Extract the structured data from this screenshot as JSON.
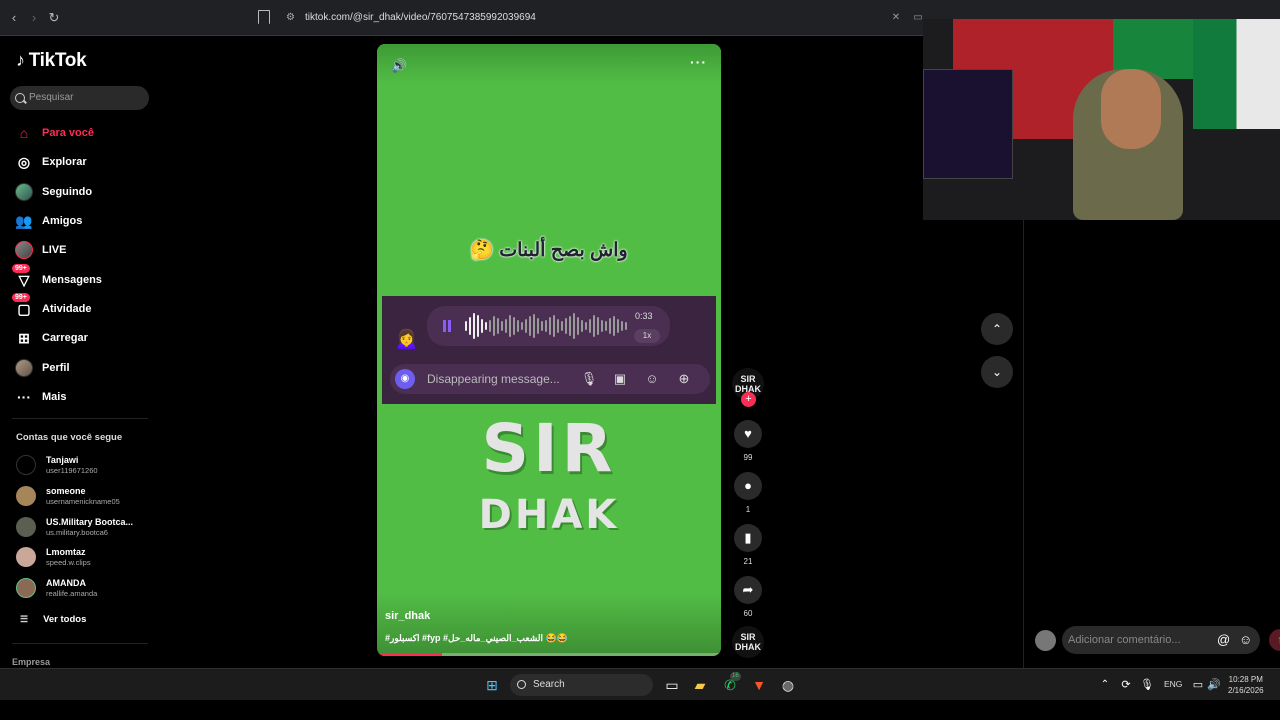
{
  "browser": {
    "url": "tiktok.com/@sir_dhak/video/7607547385992039694"
  },
  "sidebar": {
    "logo": "TikTok",
    "search_placeholder": "Pesquisar",
    "items": [
      {
        "label": "Para você",
        "icon": "home-icon",
        "active": true
      },
      {
        "label": "Explorar",
        "icon": "compass-icon"
      },
      {
        "label": "Seguindo",
        "icon": "following-avatar"
      },
      {
        "label": "Amigos",
        "icon": "friends-icon"
      },
      {
        "label": "LIVE",
        "icon": "live-avatar"
      },
      {
        "label": "Mensagens",
        "icon": "messages-icon",
        "badge": "99+"
      },
      {
        "label": "Atividade",
        "icon": "activity-icon",
        "badge": "99+"
      },
      {
        "label": "Carregar",
        "icon": "upload-icon"
      },
      {
        "label": "Perfil",
        "icon": "profile-avatar"
      },
      {
        "label": "Mais",
        "icon": "more-icon"
      }
    ],
    "following_title": "Contas que você segue",
    "following": [
      {
        "name": "Tanjawi",
        "username": "user119671260"
      },
      {
        "name": "someone",
        "username": "usernamenickname05"
      },
      {
        "name": "US.Military Bootca...",
        "username": "us.military.bootca6"
      },
      {
        "name": "Lmomtaz",
        "username": "speed.w.clips"
      },
      {
        "name": "AMANDA",
        "username": "reallife.amanda"
      }
    ],
    "see_all": "Ver todos",
    "footer": "Empresa"
  },
  "video": {
    "overlay_text": "واش بصح ألبنات 🤔",
    "voice_duration": "0:33",
    "voice_speed": "1x",
    "message_placeholder": "Disappearing message...",
    "brand_line1": "SIR",
    "brand_line2": "DHAK",
    "author": "sir_dhak",
    "caption": "#اكسبلور #fyp #الشعب_الصيني_ماله_حل 😂😂",
    "progress": 0.19
  },
  "actions": {
    "avatar_text": "SIR DHAK",
    "likes": "99",
    "comments": "1",
    "saves": "21",
    "shares": "60"
  },
  "comment": {
    "placeholder": "Adicionar comentário..."
  },
  "taskbar": {
    "search": "Search",
    "whatsapp_badge": "16",
    "lang": "ENG",
    "time": "10:28 PM",
    "date": "2/16/2026"
  },
  "colors": {
    "accent": "#fe2c55",
    "video_bg": "#52bd45"
  }
}
